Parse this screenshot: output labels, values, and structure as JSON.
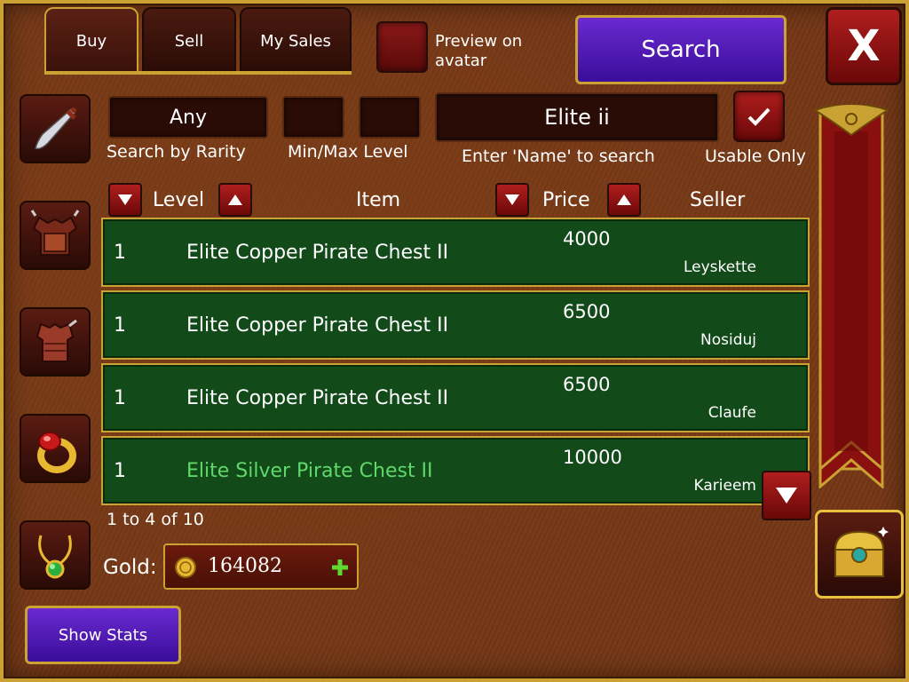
{
  "tabs": [
    {
      "label": "Buy",
      "active": true
    },
    {
      "label": "Sell",
      "active": false
    },
    {
      "label": "My Sales",
      "active": false
    }
  ],
  "preview": {
    "label": "Preview on avatar",
    "checked": false
  },
  "search_button": "Search",
  "close_button": "X",
  "filters": {
    "rarity_value": "Any",
    "rarity_caption": "Search by Rarity",
    "min_level": "",
    "max_level": "",
    "level_caption": "Min/Max Level",
    "name_value": "Elite ii",
    "name_caption": "Enter 'Name' to search",
    "usable_caption": "Usable Only",
    "usable_checked": true
  },
  "columns": {
    "level": "Level",
    "item": "Item",
    "price": "Price",
    "seller": "Seller"
  },
  "rows": [
    {
      "level": "1",
      "item": "Elite Copper Pirate Chest II",
      "price": "4000",
      "seller": "Leyskette",
      "highlight": false
    },
    {
      "level": "1",
      "item": "Elite Copper Pirate Chest II",
      "price": "6500",
      "seller": "Nosiduj",
      "highlight": false
    },
    {
      "level": "1",
      "item": "Elite Copper Pirate Chest II",
      "price": "6500",
      "seller": "Claufe",
      "highlight": false
    },
    {
      "level": "1",
      "item": "Elite Silver Pirate Chest II",
      "price": "10000",
      "seller": "Karieem",
      "highlight": true
    }
  ],
  "pagination": "1 to 4 of 10",
  "gold": {
    "label": "Gold:",
    "amount": "164082",
    "add_icon": "plus-icon"
  },
  "show_stats_button": "Show Stats",
  "side_icons": [
    "dagger-icon",
    "chest-armor-icon",
    "leather-armor-icon",
    "ring-icon",
    "amulet-icon"
  ],
  "colors": {
    "row_bg": "#134a1a",
    "gold_border": "#c9a233",
    "purple": "#4a18b0",
    "highlight_text": "#5fd96a"
  }
}
